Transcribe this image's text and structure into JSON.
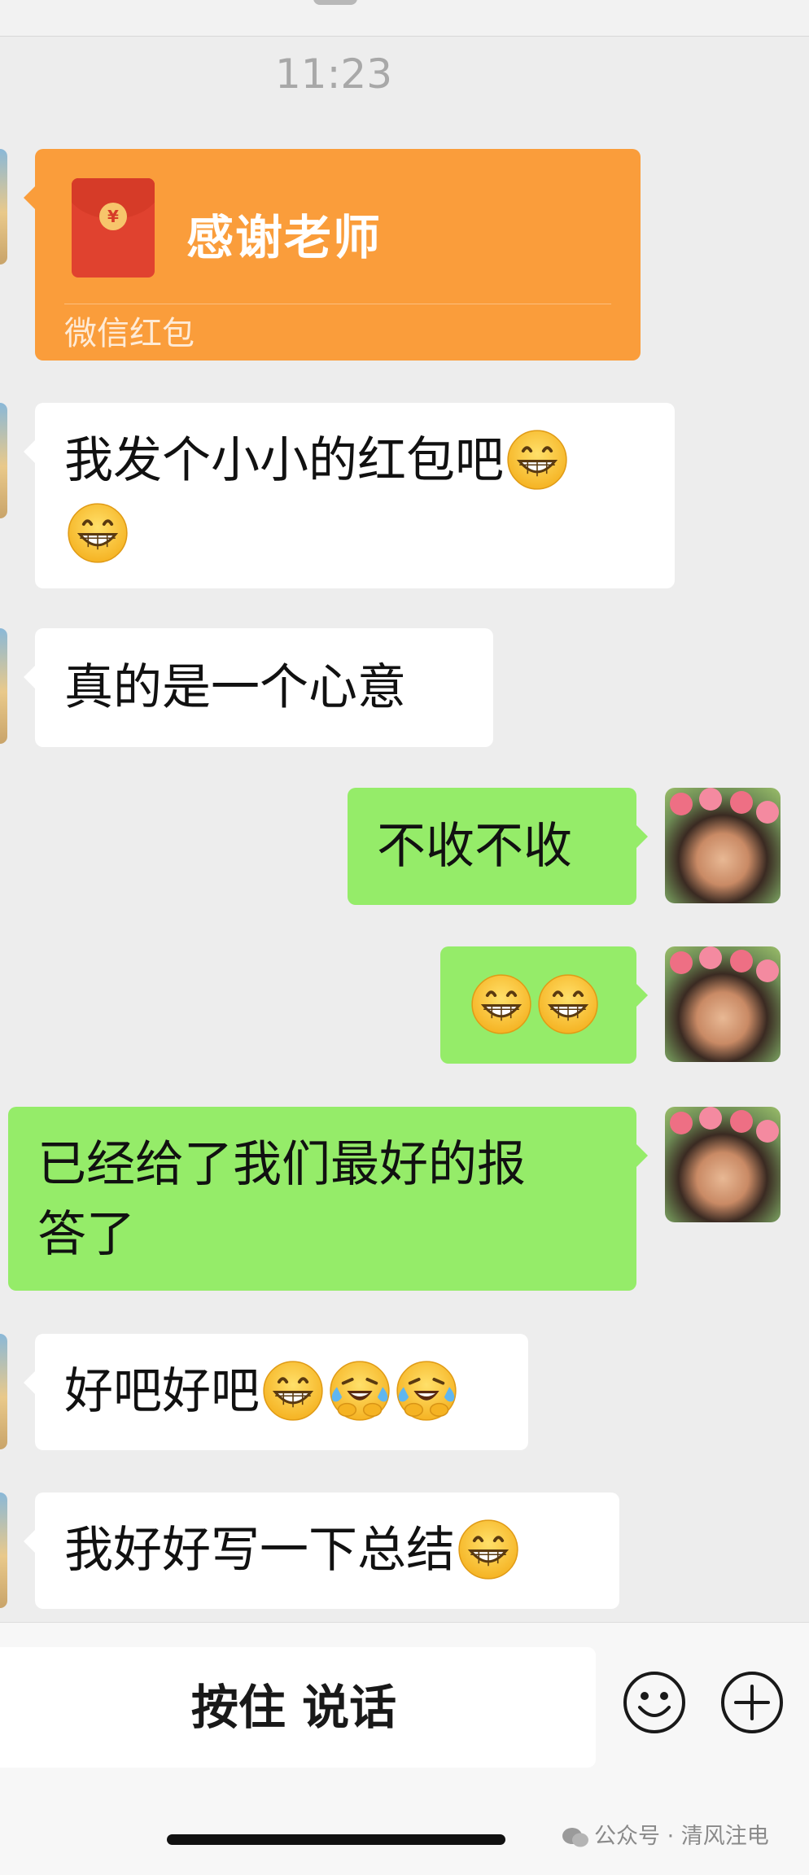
{
  "status": {
    "timestamp": "11:23"
  },
  "colors": {
    "chat_bg": "#ededed",
    "my_bubble": "#95ec69",
    "their_bubble": "#ffffff",
    "red_packet": "#fa9d3b"
  },
  "red_packet": {
    "title": "感谢老师",
    "subtitle": "微信红包",
    "coin_symbol": "¥"
  },
  "messages": [
    {
      "side": "left",
      "text": "我发个小小的红包吧",
      "trailing_emoji": [
        "grin"
      ],
      "line2_emoji": [
        "grin"
      ]
    },
    {
      "side": "left",
      "text": "真的是一个心意"
    },
    {
      "side": "right",
      "text": "不收不收"
    },
    {
      "side": "right",
      "text": "",
      "emoji": [
        "grin",
        "grin"
      ]
    },
    {
      "side": "right",
      "line1": "已经给了我们最好的报",
      "line2": "答了"
    },
    {
      "side": "left",
      "text": "好吧好吧",
      "emoji": [
        "grin",
        "tears-of-joy",
        "tears-of-joy"
      ]
    },
    {
      "side": "left",
      "text": "我好好写一下总结",
      "emoji": [
        "grin"
      ]
    }
  ],
  "input_bar": {
    "voice_button_label": "按住 说话",
    "emoji_button_icon": "smiley-face-icon",
    "more_button_icon": "plus-circle-icon"
  },
  "watermark": {
    "text": "公众号 · 清风注电",
    "icon": "wechat-icon"
  }
}
